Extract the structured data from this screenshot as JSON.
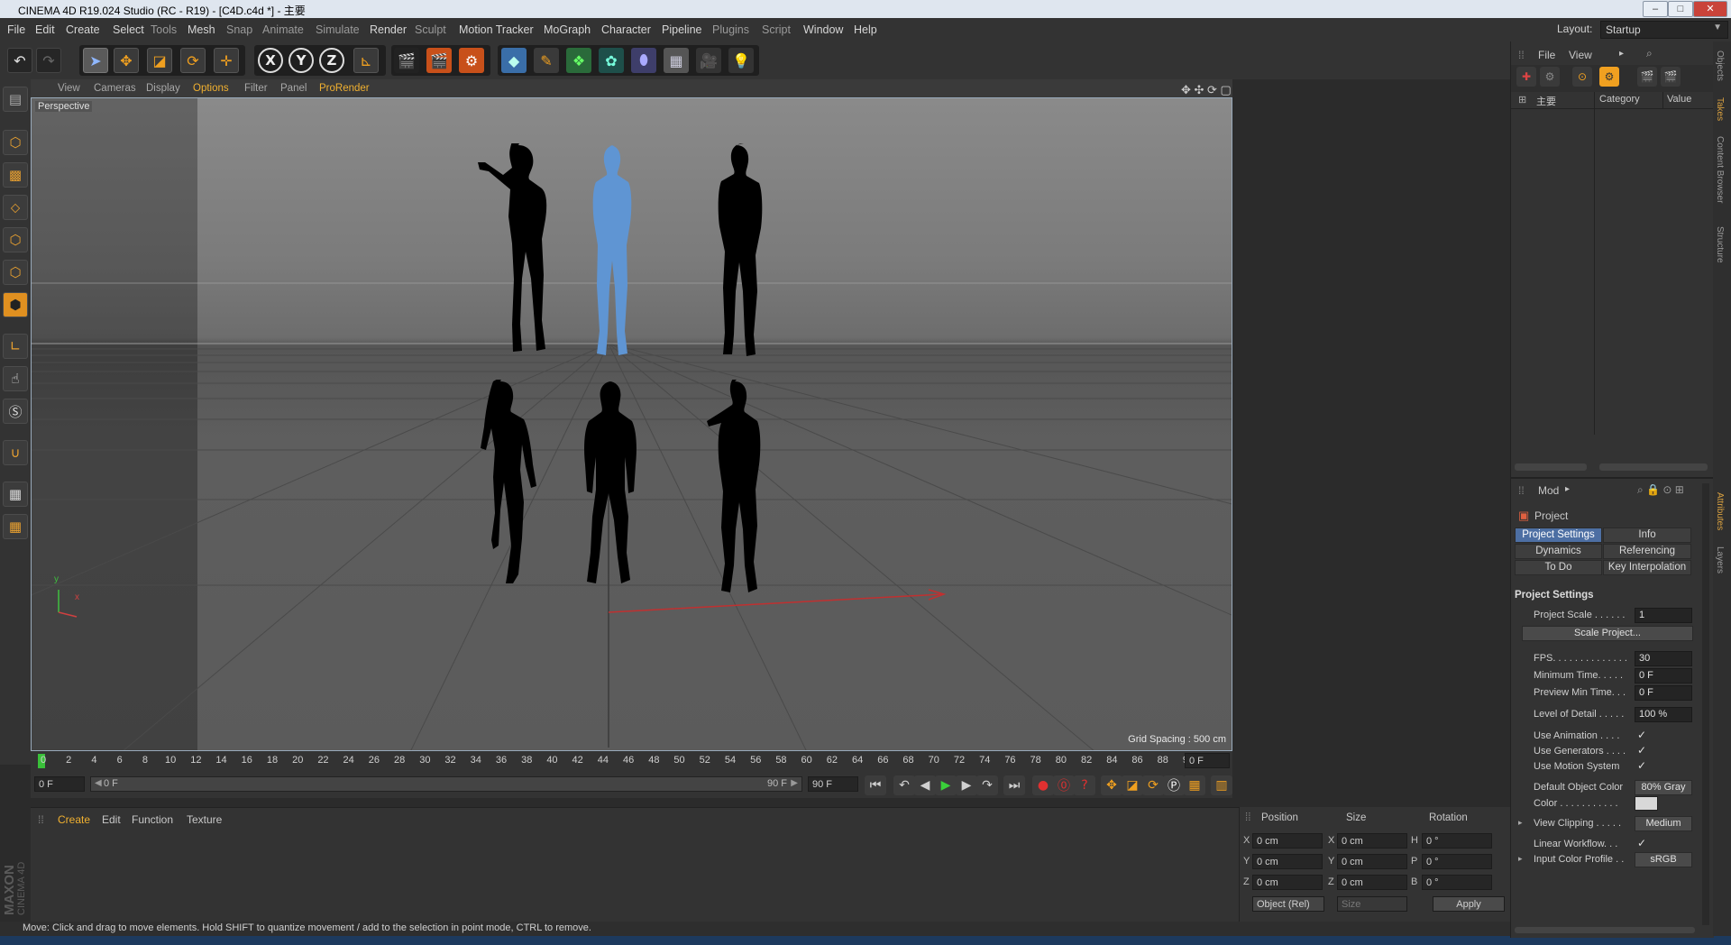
{
  "window": {
    "title": "CINEMA 4D R19.024 Studio (RC - R19) - [C4D.c4d *] - 主要"
  },
  "menu": [
    "File",
    "Edit",
    "Create",
    "Select",
    "Tools",
    "Mesh",
    "Snap",
    "Animate",
    "Simulate",
    "Render",
    "Sculpt",
    "Motion Tracker",
    "MoGraph",
    "Character",
    "Pipeline",
    "Plugins",
    "Script",
    "Window",
    "Help"
  ],
  "layout": {
    "label": "Layout:",
    "value": "Startup"
  },
  "toolbar": {
    "axis_labels": [
      "X",
      "Y",
      "Z"
    ]
  },
  "viewport": {
    "menu": [
      "View",
      "Cameras",
      "Display",
      "Options",
      "Filter",
      "Panel",
      "ProRender"
    ],
    "camera_label": "Perspective",
    "grid_spacing": "Grid Spacing : 500 cm",
    "axis_y": "y",
    "axis_x": "x",
    "figures": [
      {
        "row": "back",
        "position": "left",
        "color": "#000000",
        "selected": false
      },
      {
        "row": "back",
        "position": "center",
        "color": "#5f95d3",
        "selected": true
      },
      {
        "row": "back",
        "position": "right",
        "color": "#000000",
        "selected": false
      },
      {
        "row": "front",
        "position": "left",
        "color": "#000000",
        "selected": false
      },
      {
        "row": "front",
        "position": "center",
        "color": "#000000",
        "selected": false
      },
      {
        "row": "front",
        "position": "right",
        "color": "#000000",
        "selected": false
      }
    ]
  },
  "timeline": {
    "ticks": [
      "0",
      "2",
      "4",
      "6",
      "8",
      "10",
      "12",
      "14",
      "16",
      "18",
      "20",
      "22",
      "24",
      "26",
      "28",
      "30",
      "32",
      "34",
      "36",
      "38",
      "40",
      "42",
      "44",
      "46",
      "48",
      "50",
      "52",
      "54",
      "56",
      "58",
      "60",
      "62",
      "64",
      "66",
      "68",
      "70",
      "72",
      "74",
      "76",
      "78",
      "80",
      "82",
      "84",
      "86",
      "88",
      "90"
    ],
    "current_frame": "0 F",
    "start": "0 F",
    "slider_start": "0 F",
    "slider_end": "90 F",
    "end": "90 F"
  },
  "materials": {
    "menu": [
      "Create",
      "Edit",
      "Function",
      "Texture"
    ],
    "brand_top": "MAXON",
    "brand_bottom": "CINEMA 4D"
  },
  "coordinates": {
    "headers": [
      "Position",
      "Size",
      "Rotation"
    ],
    "rows": [
      {
        "pos_axis": "X",
        "pos": "0 cm",
        "size_axis": "X",
        "size": "0 cm",
        "rot_axis": "H",
        "rot": "0 °"
      },
      {
        "pos_axis": "Y",
        "pos": "0 cm",
        "size_axis": "Y",
        "size": "0 cm",
        "rot_axis": "P",
        "rot": "0 °"
      },
      {
        "pos_axis": "Z",
        "pos": "0 cm",
        "size_axis": "Z",
        "size": "0 cm",
        "rot_axis": "B",
        "rot": "0 °"
      }
    ],
    "mode": "Object (Rel)",
    "size_mode": "Size",
    "apply": "Apply"
  },
  "status": "Move: Click and drag to move elements. Hold SHIFT to quantize movement / add to the selection in point mode, CTRL to remove.",
  "objects": {
    "menu": [
      "File",
      "View"
    ],
    "tree_item": "主要",
    "col_category": "Category",
    "col_value": "Value"
  },
  "attributes": {
    "mode": "Mod",
    "title": "Project",
    "tabs": [
      {
        "label": "Project Settings",
        "active": true
      },
      {
        "label": "Info",
        "active": false
      },
      {
        "label": "Dynamics",
        "active": false
      },
      {
        "label": "Referencing",
        "active": false
      },
      {
        "label": "To Do",
        "active": false
      },
      {
        "label": "Key Interpolation",
        "active": false
      }
    ],
    "section": "Project Settings",
    "props": {
      "project_scale": {
        "label": "Project Scale . . . . . .",
        "value": "1"
      },
      "scale_project": "Scale Project...",
      "fps": {
        "label": "FPS. . . . . . . . . . . . . .",
        "value": "30"
      },
      "min_time": {
        "label": "Minimum Time. . . . .",
        "value": "0 F"
      },
      "preview_min": {
        "label": "Preview Min Time. . .",
        "value": "0 F"
      },
      "lod": {
        "label": "Level of Detail . . . . .",
        "value": "100 %"
      },
      "use_animation": {
        "label": "Use Animation . . . .",
        "value": "✓"
      },
      "use_generators": {
        "label": "Use Generators . . . .",
        "value": "✓"
      },
      "use_motion": {
        "label": "Use Motion System",
        "value": "✓"
      },
      "default_color": {
        "label": "Default Object Color",
        "value": "80% Gray"
      },
      "color": {
        "label": "Color . . . . . . . . . . .",
        "value": "#d8d8d8"
      },
      "view_clipping": {
        "label": "View Clipping . . . . .",
        "value": "Medium"
      },
      "linear_workflow": {
        "label": "Linear Workflow. . .",
        "value": "✓"
      },
      "input_color_profile": {
        "label": "Input Color Profile . .",
        "value": "sRGB"
      }
    }
  },
  "side_tabs": [
    "Objects",
    "Takes",
    "Content Browser",
    "Structure",
    "Attributes",
    "Layers"
  ]
}
